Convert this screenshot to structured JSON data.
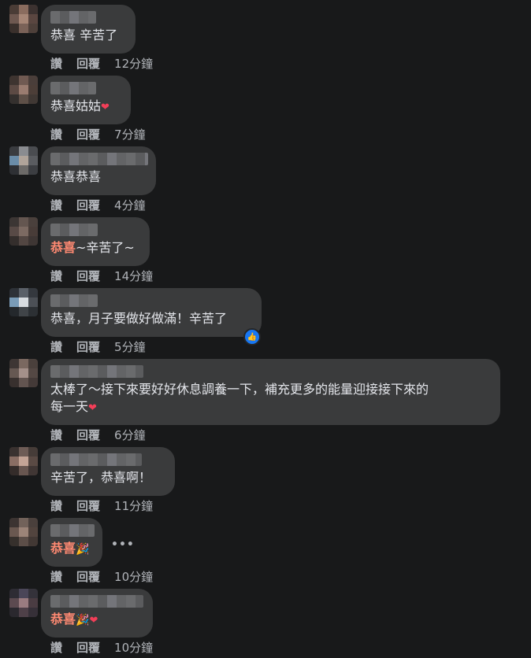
{
  "labels": {
    "like": "讚",
    "reply": "回覆"
  },
  "comments": [
    {
      "text": "恭喜 辛苦了",
      "time": "12分鐘"
    },
    {
      "text": "恭喜姑姑",
      "time": "7分鐘"
    },
    {
      "text": "恭喜恭喜",
      "time": "4分鐘"
    },
    {
      "highlight": "恭喜",
      "text": "~辛苦了~",
      "time": "14分鐘"
    },
    {
      "text": "恭喜，月子要做好做滿！辛苦了",
      "time": "5分鐘"
    },
    {
      "line1": "太棒了～接下來要好好休息調養一下，補充更多的能量迎接接下來的",
      "line2": "每一天",
      "time": "6分鐘"
    },
    {
      "text": "辛苦了，恭喜啊！",
      "time": "11分鐘"
    },
    {
      "highlight": "恭喜",
      "time": "10分鐘"
    },
    {
      "highlight": "恭喜",
      "time": "10分鐘"
    }
  ],
  "colors": {
    "background": "#18191a",
    "bubble": "#3a3b3c",
    "highlight": "#ff8a72",
    "heart": "#f33e58",
    "like_blue": "#1877f2"
  },
  "icons": {
    "heart": "❤",
    "party": "🎉",
    "like": "👍",
    "more": "•••"
  }
}
